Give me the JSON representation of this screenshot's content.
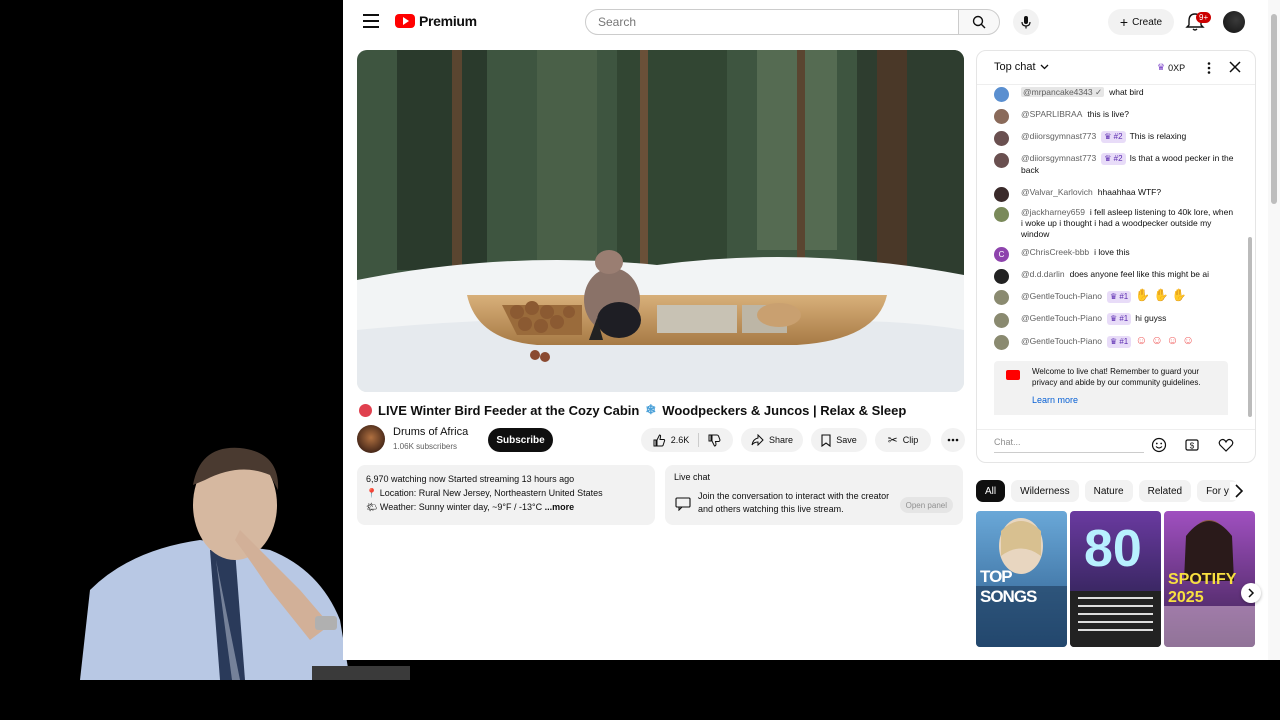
{
  "header": {
    "logo_text": "Premium",
    "search_placeholder": "Search",
    "create_label": "Create",
    "notif_badge": "9+"
  },
  "video": {
    "title_part1": "LIVE Winter Bird Feeder at the Cozy Cabin",
    "title_part2": "Woodpeckers & Juncos | Relax & Sleep",
    "channel_name": "Drums of Africa",
    "subscribers": "1.06K subscribers",
    "subscribe_label": "Subscribe",
    "likes": "2.6K",
    "share_label": "Share",
    "save_label": "Save",
    "clip_label": "Clip"
  },
  "description": {
    "line1": "6,970 watching now  Started streaming 13 hours ago",
    "line2": "📍 Location: Rural New Jersey, Northeastern United States",
    "line3": "🌤 Weather: Sunny winter day, ~9°F / -13°C",
    "more": "...more"
  },
  "live_chat_card": {
    "title": "Live chat",
    "text": "Join the conversation to interact with the creator and others watching this live stream.",
    "button": "Open panel"
  },
  "chat": {
    "title": "Top chat",
    "xp": "0XP",
    "messages": [
      {
        "author": "@mrpancake4343 ✓",
        "text": "what bird",
        "badge": "",
        "color": "#5a8fd0"
      },
      {
        "author": "@SPARLIBRAA",
        "text": "this is live?",
        "badge": "",
        "color": "#8a6a5a"
      },
      {
        "author": "@diiorsgymnast773",
        "text": "This is relaxing",
        "badge": "#2",
        "color": "#6a5050"
      },
      {
        "author": "@diiorsgymnast773",
        "text": "Is that a wood pecker in the back",
        "badge": "#2",
        "color": "#6a5050"
      },
      {
        "author": "@Valvar_Karlovich",
        "text": "hhaahhaa WTF?",
        "badge": "",
        "color": "#3a2a2a"
      },
      {
        "author": "@jackharney659",
        "text": "i fell asleep listening to 40k lore, when i woke up i thought i had a woodpecker outside my window",
        "badge": "",
        "color": "#7a8a5a"
      },
      {
        "author": "@ChrisCreek-bbb",
        "text": "i love this",
        "badge": "",
        "color": "#8e44ad"
      },
      {
        "author": "@d.d.darlin",
        "text": "does anyone feel like this might be ai",
        "badge": "",
        "color": "#222222"
      },
      {
        "author": "@GentleTouch-Piano",
        "text": "",
        "badge": "#1",
        "color": "#8a8a70"
      },
      {
        "author": "@GentleTouch-Piano",
        "text": "hi guyss",
        "badge": "#1",
        "color": "#8a8a70"
      },
      {
        "author": "@GentleTouch-Piano",
        "text": "",
        "badge": "#1",
        "color": "#8a8a70"
      }
    ],
    "welcome_text": "Welcome to live chat! Remember to guard your privacy and abide by our community guidelines.",
    "learn_more": "Learn more",
    "input_placeholder": "Chat..."
  },
  "chips": [
    "All",
    "Wilderness",
    "Nature",
    "Related",
    "For y"
  ],
  "recommendations": [
    {
      "title": "TOP SONGS",
      "colors": [
        "#6aa8d8",
        "#2a5a8a"
      ]
    },
    {
      "title": "80",
      "colors": [
        "#6a3aa0",
        "#1a1a3a"
      ]
    },
    {
      "title": "SPOTIFY 2025",
      "colors": [
        "#a050c0",
        "#3a2050"
      ]
    }
  ],
  "colors": {
    "brand_red": "#ff0000",
    "live_red": "#e0404e",
    "link_blue": "#065fd4",
    "badge_purple": "#5b2bb0"
  }
}
